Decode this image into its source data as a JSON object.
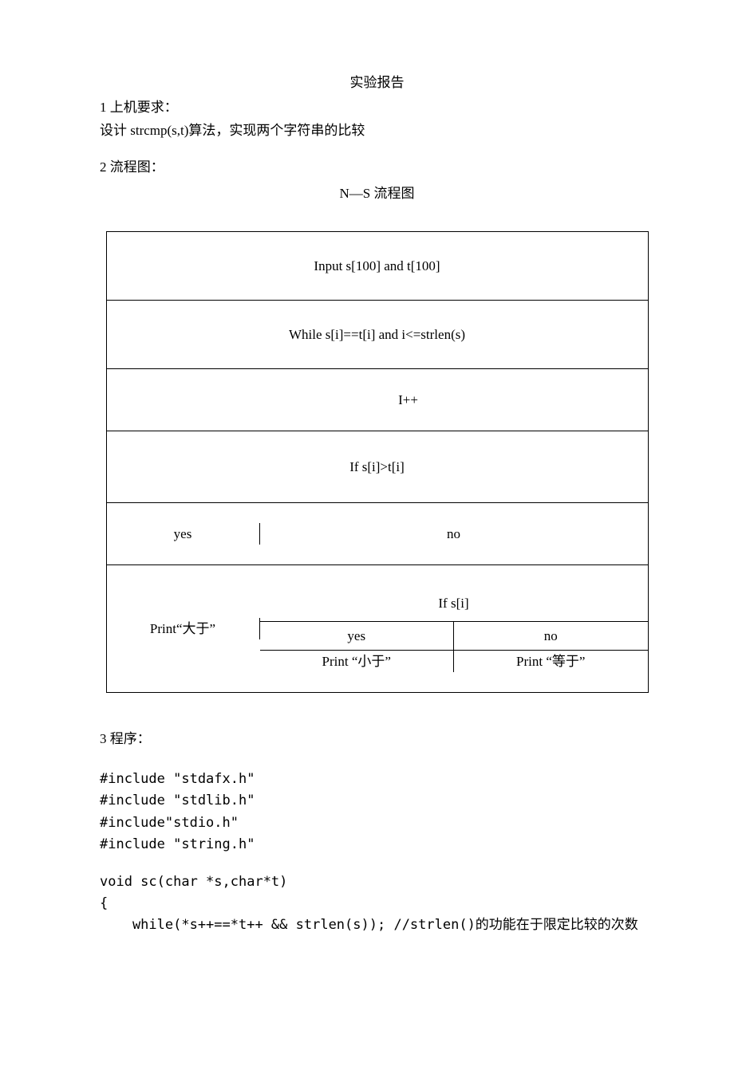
{
  "title": "实验报告",
  "section1": {
    "label": "1 上机要求：",
    "desc": "设计 strcmp(s,t)算法，实现两个字符串的比较"
  },
  "section2": {
    "label": "2 流程图：",
    "ns_title": "N—S 流程图"
  },
  "diagram": {
    "input": "Input s[100] and t[100]",
    "while": "While s[i]==t[i] and i<=strlen(s)",
    "ipp": "I++",
    "if_main": "If s[i]>t[i]",
    "yes": "yes",
    "no": "no",
    "print_left": "Print“大于”",
    "sub_if": "If s[i]",
    "sub_yes": "yes",
    "sub_no": "no",
    "print_sub_yes": "Print “小于”",
    "print_sub_no": "Print “等于”"
  },
  "section3": {
    "label": "3 程序："
  },
  "code": {
    "l1": "#include \"stdafx.h\"",
    "l2": "#include \"stdlib.h\"",
    "l3": "#include\"stdio.h\"",
    "l4": "#include \"string.h\"",
    "l5": "void sc(char *s,char*t)",
    "l6": "{",
    "l7": "    while(*s++==*t++ && strlen(s)); //strlen()的功能在于限定比较的次数"
  }
}
